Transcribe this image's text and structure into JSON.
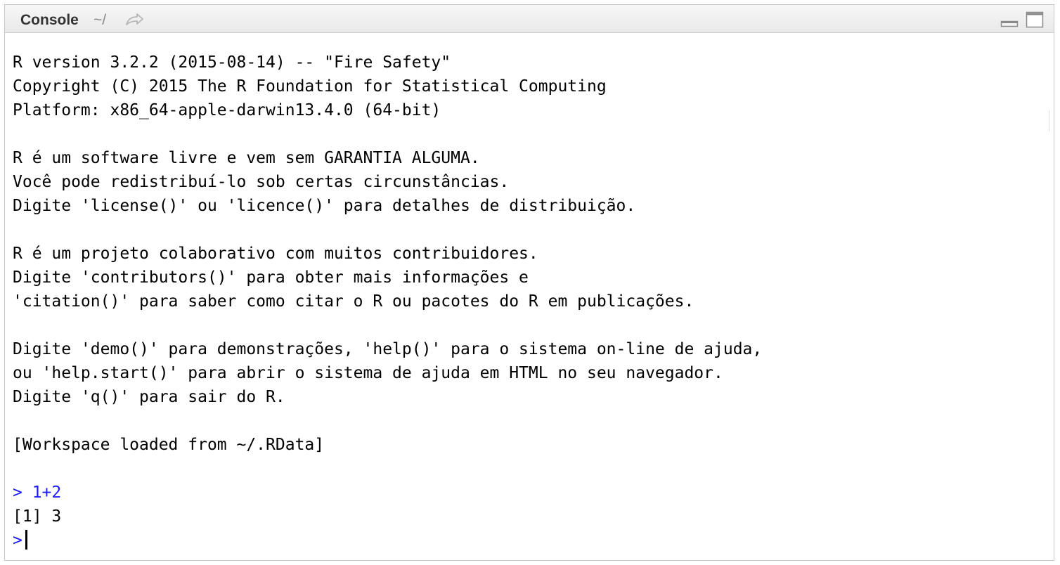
{
  "window": {
    "title": "Console",
    "path": "~/",
    "icons": {
      "navigate": "go-to-directory-arrow-icon",
      "minimize": "minimize-icon",
      "maximize": "maximize-icon"
    }
  },
  "console": {
    "banner": [
      "R version 3.2.2 (2015-08-14) -- \"Fire Safety\"",
      "Copyright (C) 2015 The R Foundation for Statistical Computing",
      "Platform: x86_64-apple-darwin13.4.0 (64-bit)",
      "",
      "R é um software livre e vem sem GARANTIA ALGUMA.",
      "Você pode redistribuí-lo sob certas circunstâncias.",
      "Digite 'license()' ou 'licence()' para detalhes de distribuição.",
      "",
      "R é um projeto colaborativo com muitos contribuidores.",
      "Digite 'contributors()' para obter mais informações e",
      "'citation()' para saber como citar o R ou pacotes do R em publicações.",
      "",
      "Digite 'demo()' para demonstrações, 'help()' para o sistema on-line de ajuda,",
      "ou 'help.start()' para abrir o sistema de ajuda em HTML no seu navegador.",
      "Digite 'q()' para sair do R.",
      "",
      "[Workspace loaded from ~/.RData]",
      ""
    ],
    "command": "> 1+2",
    "output": "[1] 3",
    "prompt": ">"
  },
  "colors": {
    "input": "#1a1aff",
    "output": "#000000"
  }
}
